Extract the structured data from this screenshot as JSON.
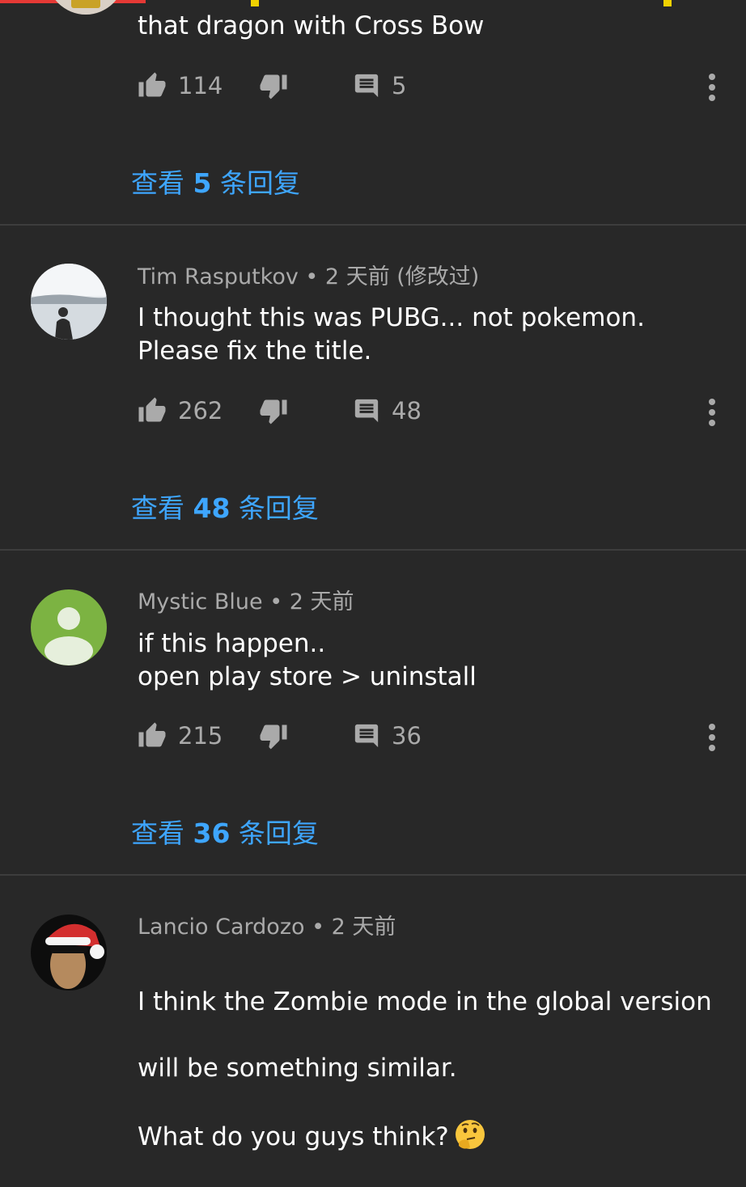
{
  "colors": {
    "background": "#282828",
    "link": "#3ea6ff",
    "muted": "#aaaaaa",
    "divider": "#3d3d3d",
    "avatar_green": "#7cb342"
  },
  "comments": [
    {
      "text": "that dragon with Cross Bow",
      "likes": "114",
      "replies": "5",
      "view_replies": {
        "prefix": "查看 ",
        "count": "5",
        "suffix": " 条回复"
      }
    },
    {
      "author": "Tim Rasputkov",
      "meta": " • 2 天前 (修改过)",
      "text": "I thought this was PUBG... not pokemon.\nPlease fix the title.",
      "likes": "262",
      "replies": "48",
      "view_replies": {
        "prefix": "查看 ",
        "count": "48",
        "suffix": " 条回复"
      }
    },
    {
      "author": "Mystic Blue",
      "meta": " • 2 天前",
      "text": "if this happen..\nopen play store > uninstall",
      "likes": "215",
      "replies": "36",
      "view_replies": {
        "prefix": "查看 ",
        "count": "36",
        "suffix": " 条回复"
      }
    },
    {
      "author": "Lancio Cardozo",
      "meta": " • 2 天前",
      "text_lines": [
        "I think the Zombie mode in the global version",
        "will be something similar.",
        "What do you guys think?"
      ],
      "emoji": "thinking-face"
    }
  ],
  "icons": {
    "like": "thumb-up-icon",
    "dislike": "thumb-down-icon",
    "reply": "comment-icon",
    "menu": "more-vertical-icon"
  }
}
